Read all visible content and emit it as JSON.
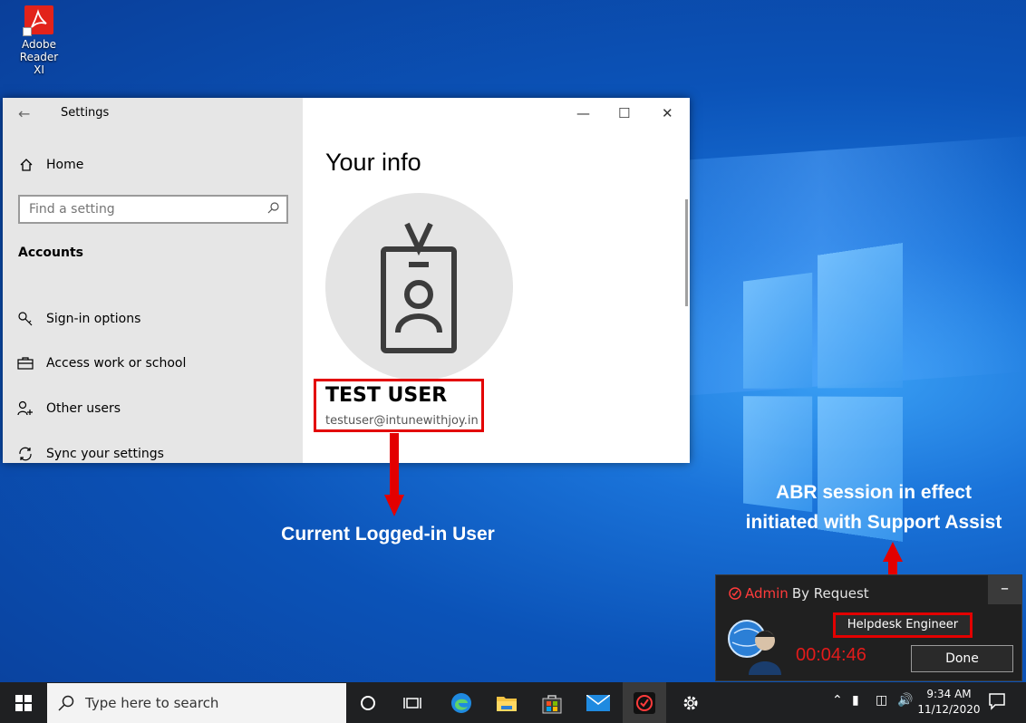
{
  "desktop": {
    "icon_label_line1": "Adobe Reader",
    "icon_label_line2": "XI"
  },
  "settings": {
    "title": "Settings",
    "home_label": "Home",
    "search_placeholder": "Find a setting",
    "section": "Accounts",
    "nav_items": [
      {
        "label": "Sign-in options",
        "icon": "key-icon"
      },
      {
        "label": "Access work or school",
        "icon": "briefcase-icon"
      },
      {
        "label": "Other users",
        "icon": "add-person-icon"
      },
      {
        "label": "Sync your settings",
        "icon": "sync-icon"
      }
    ],
    "heading": "Your info",
    "username": "TEST USER",
    "email": "testuser@intunewithjoy.in"
  },
  "annotations": {
    "left_label": "Current Logged-in User",
    "right_line1": "ABR session in effect",
    "right_line2": "initiated with Support Assist",
    "highlight_color": "#e30000"
  },
  "abr": {
    "brand_prefix": "Admin",
    "brand_suffix": "By Request",
    "minimize_label": "–",
    "role": "Helpdesk Engineer",
    "timer": "00:04:46",
    "done_label": "Done"
  },
  "taskbar": {
    "search_placeholder": "Type here to search",
    "time": "9:34 AM",
    "date": "11/12/2020"
  }
}
